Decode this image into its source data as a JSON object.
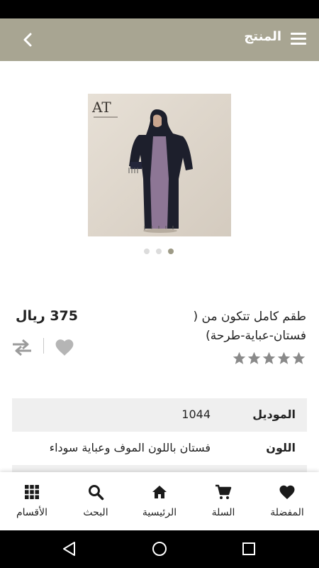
{
  "app_bar": {
    "title": "المنتج",
    "menu_icon": "hamburger-menu-icon",
    "back_icon": "chevron-back-icon",
    "color": "#a8a592"
  },
  "product": {
    "title_line1": "طقم كامل تتكون من (",
    "title_line2": "فستان-عباية-طرحة)",
    "price": "375 ريال",
    "rating": 0,
    "rating_max": 5,
    "image_logo": "AT"
  },
  "carousel": {
    "count": 3,
    "active": 3
  },
  "specs": [
    {
      "label": "الموديل",
      "value": "1044"
    },
    {
      "label": "اللون",
      "value": "فستان باللون الموف وعباية سوداء"
    }
  ],
  "bottom_nav": [
    {
      "label": "المفضلة",
      "icon": "heart-icon"
    },
    {
      "label": "السلة",
      "icon": "cart-icon"
    },
    {
      "label": "الرئيسية",
      "icon": "home-icon"
    },
    {
      "label": "البحث",
      "icon": "search-icon"
    },
    {
      "label": "الأقسام",
      "icon": "grid-icon"
    }
  ],
  "system_nav": [
    "back-triangle-icon",
    "home-circle-icon",
    "recents-square-icon"
  ]
}
